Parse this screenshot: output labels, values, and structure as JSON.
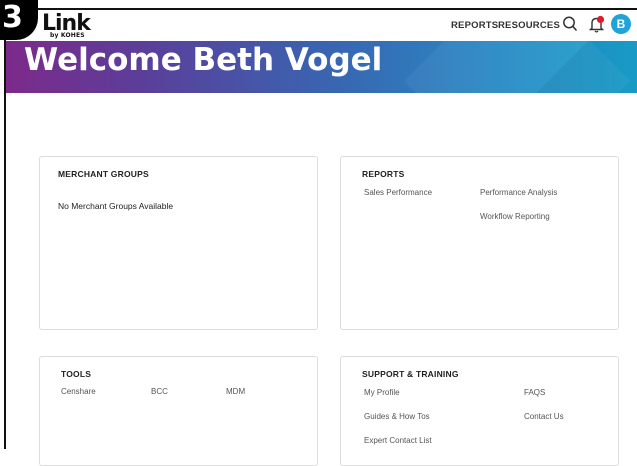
{
  "step_badge": "3",
  "logo": {
    "main": "Link",
    "sub": "by KOHES"
  },
  "nav": {
    "reports": "REPORTS",
    "resources": "RESOURCES"
  },
  "user": {
    "avatar_initial": "B"
  },
  "hero": {
    "title": "Welcome Beth Vogel"
  },
  "merchant_groups": {
    "title": "MERCHANT GROUPS",
    "empty_text": "No Merchant Groups Available"
  },
  "reports": {
    "title": "REPORTS",
    "links": [
      "Sales Performance",
      "Performance Analysis",
      "Workflow Reporting"
    ]
  },
  "tools": {
    "title": "TOOLS",
    "links": [
      "Censhare",
      "BCC",
      "MDM"
    ]
  },
  "support": {
    "title": "SUPPORT & TRAINING",
    "links": [
      "My Profile",
      "FAQS",
      "Guides & How Tos",
      "Contact Us",
      "Expert Contact List"
    ]
  },
  "colors": {
    "avatar": "#1fa3d8",
    "hero_start": "#7d2a8a",
    "hero_end": "#1ba6cf",
    "bell_dot": "#e21b2c"
  }
}
